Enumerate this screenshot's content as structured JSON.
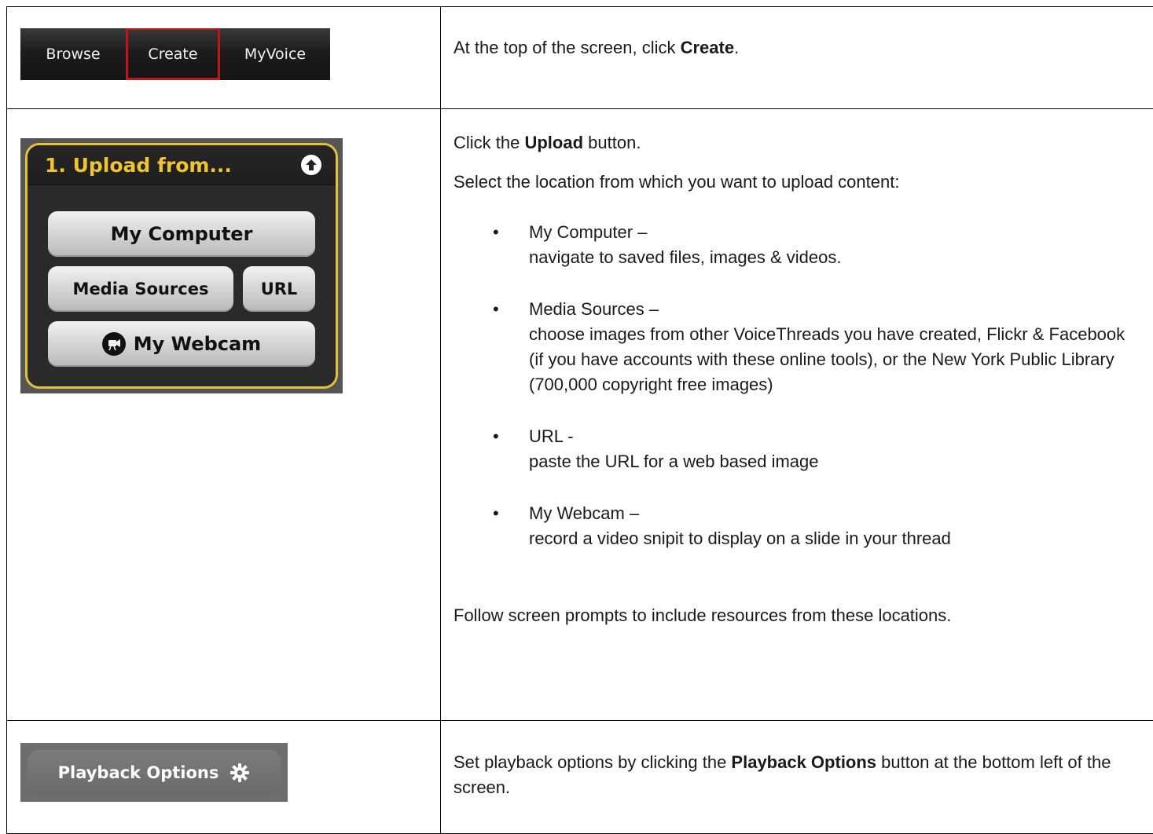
{
  "navbar": {
    "tabs": [
      {
        "label": "Browse"
      },
      {
        "label": "Create"
      },
      {
        "label": "MyVoice"
      }
    ]
  },
  "row1": {
    "text_before": "At the top of the screen, click ",
    "bold": "Create",
    "text_after": "."
  },
  "upload_panel": {
    "title": "1. Upload from...",
    "my_computer": "My Computer",
    "media_sources": "Media Sources",
    "url": "URL",
    "my_webcam": "My Webcam"
  },
  "row2": {
    "click_before": "Click the ",
    "click_bold": "Upload",
    "click_after": " button.",
    "select_text": "Select the location from which you want to upload content:",
    "items": [
      {
        "title": "My Computer –",
        "desc": "navigate to saved files, images & videos."
      },
      {
        "title": "Media Sources –",
        "desc": "choose images from other VoiceThreads you have created, Flickr & Facebook (if you have  accounts with these online tools), or the New York Public Library (700,000 copyright free images)"
      },
      {
        "title": "URL  -",
        "desc": "paste the URL for a web based image"
      },
      {
        "title": "My Webcam –",
        "desc": "record a video snipit to display on a slide in your thread"
      }
    ],
    "follow_text": "Follow screen prompts to include resources from these locations."
  },
  "playback": {
    "label": "Playback Options"
  },
  "row3": {
    "text_before": "Set playback options by clicking the ",
    "bold": "Playback Options",
    "text_after": " button at the bottom left of the screen."
  }
}
